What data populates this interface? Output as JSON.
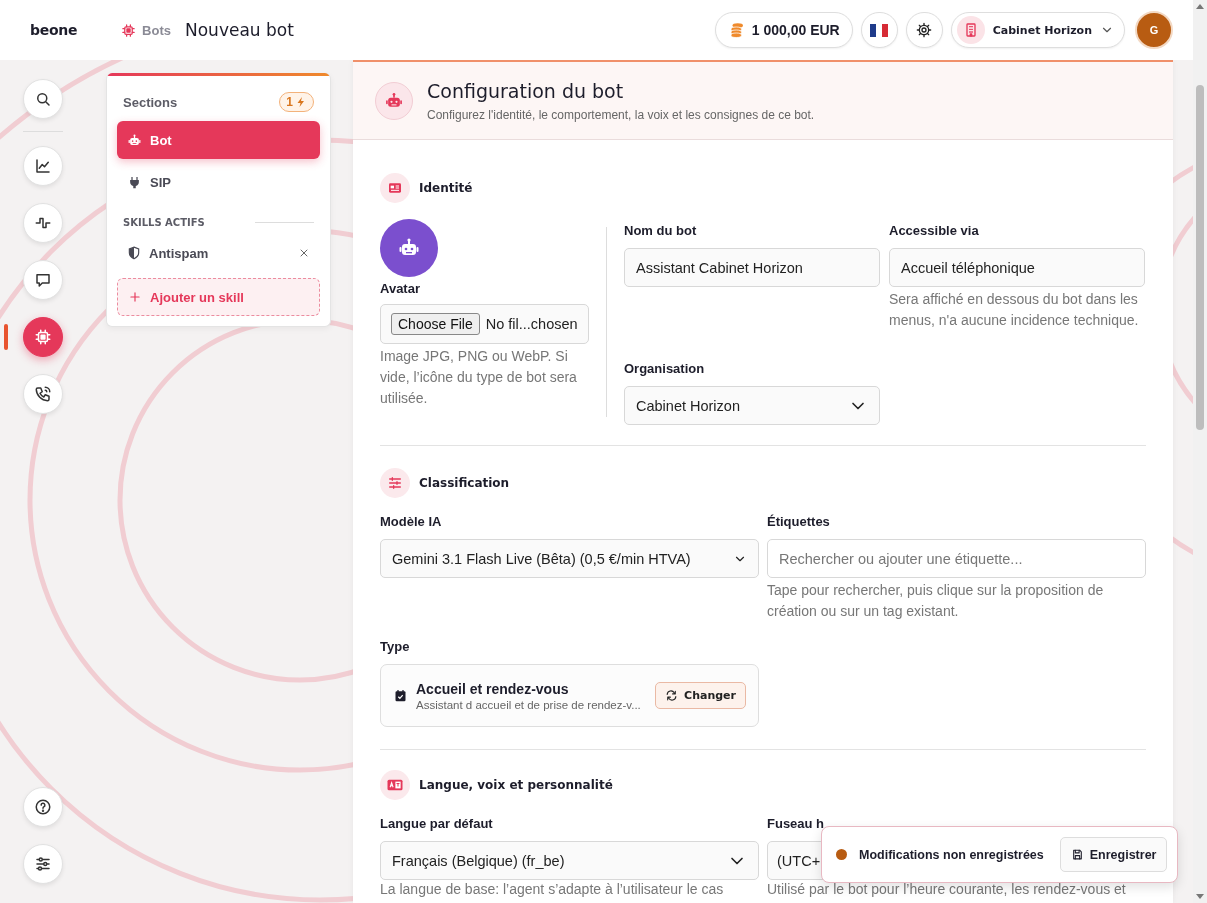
{
  "header": {
    "logo": "beone",
    "breadcrumb": "Bots",
    "title": "Nouveau bot",
    "balance": "1 000,00 EUR",
    "organization": "Cabinet Horizon",
    "avatar_initial": "G"
  },
  "rail": {
    "items": [
      {
        "kind": "search",
        "selected": false
      },
      {
        "kind": "chart",
        "selected": false
      },
      {
        "kind": "pulse",
        "selected": false
      },
      {
        "kind": "chat",
        "selected": false
      },
      {
        "kind": "chip",
        "selected": true
      },
      {
        "kind": "phone",
        "selected": false
      }
    ],
    "bottom_items": [
      {
        "kind": "help",
        "selected": false
      },
      {
        "kind": "sliders",
        "selected": false
      }
    ]
  },
  "sections": {
    "title": "Sections",
    "badge": "1",
    "items": [
      {
        "label": "Bot",
        "kind": "robot",
        "selected": true
      },
      {
        "label": "SIP",
        "kind": "plug",
        "selected": false
      }
    ],
    "skills_title": "SKILLS ACTIFS",
    "skills": [
      {
        "label": "Antispam"
      }
    ],
    "add_skill": "Ajouter un skill"
  },
  "config": {
    "title": "Configuration du bot",
    "subtitle": "Configurez l'identité, le comportement, la voix et les consignes de ce bot.",
    "identity": {
      "title": "Identité",
      "avatar_label": "Avatar",
      "file_button": "Choose File",
      "file_name": "No fil...chosen",
      "avatar_help": "Image JPG, PNG ou WebP. Si vide, l’icône du type de bot sera utilisée.",
      "bot_name": {
        "label": "Nom du bot",
        "value": "Assistant Cabinet Horizon"
      },
      "accessible_via": {
        "label": "Accessible via",
        "value": "Accueil téléphonique",
        "help": "Sera affiché en dessous du bot dans les menus, n'a aucune incidence technique."
      },
      "organisation": {
        "label": "Organisation",
        "value": "Cabinet Horizon"
      }
    },
    "classification": {
      "title": "Classification",
      "model": {
        "label": "Modèle IA",
        "value": "Gemini 3.1 Flash Live (Bêta) (0,5 €/min HTVA)"
      },
      "tags": {
        "label": "Étiquettes",
        "placeholder": "Rechercher ou ajouter une étiquette...",
        "help": "Tape pour rechercher, puis clique sur la proposition de création ou sur un tag existant."
      },
      "type": {
        "label": "Type",
        "name": "Accueil et rendez-vous",
        "description": "Assistant d accueil et de prise de rendez-v...",
        "button": "Changer"
      }
    },
    "language": {
      "title": "Langue, voix et personnalité",
      "default_language": {
        "label": "Langue par défaut",
        "value": "Français (Belgique) (fr_be)",
        "help": "La langue de base: l’agent s’adapte à l’utilisateur le cas"
      },
      "timezone": {
        "label": "Fuseau h",
        "value": "(UTC+",
        "help": "Utilisé par le bot pour l’heure courante, les rendez-vous et"
      }
    }
  },
  "toast": {
    "message": "Modifications non enregistrées",
    "button": "Enregistrer"
  }
}
